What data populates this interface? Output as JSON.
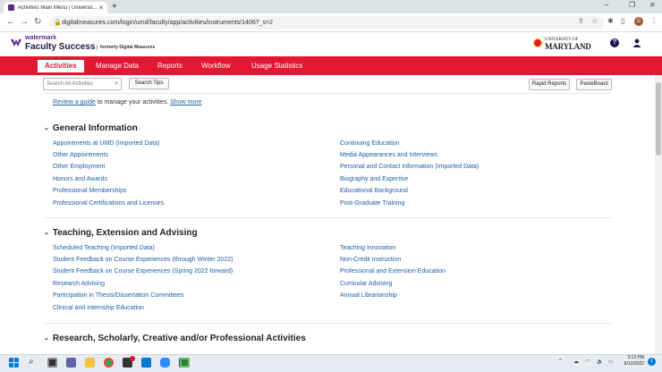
{
  "browser": {
    "tab_title": "Activities Main Menu | Universit...",
    "url": "digitalmeasures.com/login/umd/faculty/app/activities/instruments/1406?_s=2",
    "profile_initial": "G"
  },
  "brand": {
    "watermark": "watermark",
    "product": "Faculty Success",
    "formerly": "formerly Digital Measures",
    "university_small": "UNIVERSITY OF",
    "university_big": "MARYLAND"
  },
  "nav": {
    "items": [
      "Activities",
      "Manage Data",
      "Reports",
      "Workflow",
      "Usage Statistics"
    ]
  },
  "toolbar": {
    "search_placeholder": "Search All Activities",
    "search_tips": "Search Tips",
    "rapid_reports": "Rapid Reports",
    "pasteboard": "PasteBoard"
  },
  "review": {
    "link": "Review a guide",
    "text": " to manage your activities. ",
    "show_more": "Show more"
  },
  "sections": [
    {
      "title": "General Information",
      "left": [
        "Appointments at UMD (Imported Data)",
        "Other Appointments",
        "Other Employment",
        "Honors and Awards",
        "Professional Memberships",
        "Professional Certifications and Licenses"
      ],
      "right": [
        "Continuing Education",
        "Media Appearances and Interviews",
        "Personal and Contact Information (Imported Data)",
        "Biography and Expertise",
        "Educational Background",
        "Post-Graduate Training"
      ]
    },
    {
      "title": "Teaching, Extension and Advising",
      "left": [
        "Scheduled Teaching (Imported Data)",
        "Student Feedback on Course Experiences (through Winter 2022)",
        "Student Feedback on Course Experiences (Spring 2022 forward)",
        "Research Advising",
        "Participation in Thesis/Dissertation Committees",
        "Clinical and Internship Education"
      ],
      "right": [
        "Teaching Innovation",
        "Non-Credit Instruction",
        "Professional and Extension Education",
        "Curricular Advising",
        "Annual Librarianship"
      ]
    },
    {
      "title": "Research, Scholarly, Creative and/or Professional Activities",
      "left": [],
      "right": []
    }
  ],
  "taskbar": {
    "time": "3:13 PM",
    "date": "8/12/2022",
    "badge": "1"
  },
  "colors": {
    "umd_red": "#e21833",
    "link_blue": "#1f5fa8",
    "watermark_purple": "#5b2a86"
  }
}
